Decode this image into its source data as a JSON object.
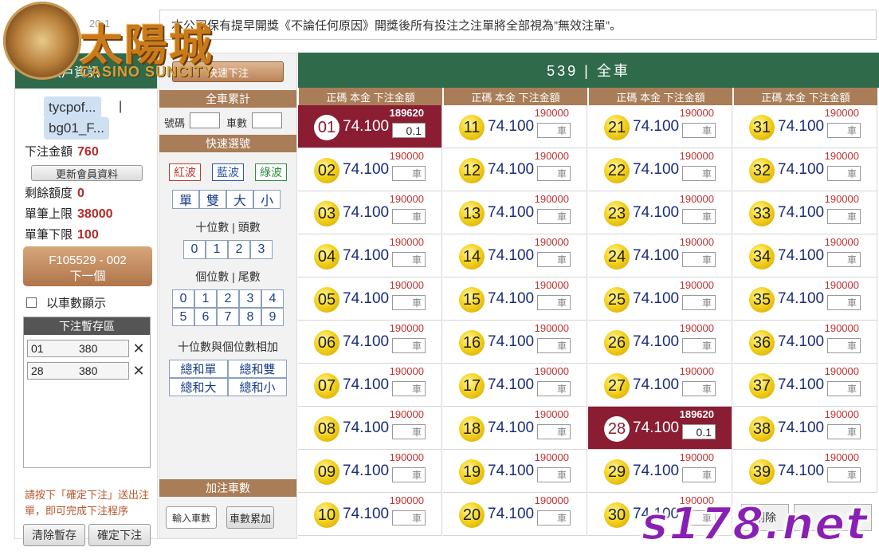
{
  "date_fragment": "20-1",
  "marquee": "本公司保有提早開獎《不論任何原因》開獎後所有投注之注單將全部視為”無效注單”。",
  "logo": {
    "title": "太陽城",
    "subtitle": "CASINO SUNCITY"
  },
  "member": {
    "header": "帳戶資訊",
    "user1": "tycpof...",
    "separator": "|",
    "user2": "bg01_F...",
    "bet_amount_label": "下注金額",
    "bet_amount": "760",
    "update_btn": "更新會員資料",
    "balance_label": "剩餘額度",
    "balance": "0",
    "max_label": "單筆上限",
    "max": "38000",
    "min_label": "單筆下限",
    "min": "100",
    "next_line1": "F105529 - 002",
    "next_line2": "下一個",
    "by_count_label": "以車數顯示",
    "stash_title": "下注暫存區",
    "stash": [
      {
        "num": "01",
        "amount": "380"
      },
      {
        "num": "28",
        "amount": "380"
      }
    ],
    "hint": "請按下「確定下注」送出注單，即可完成下注程序",
    "clear_btn": "清除暫存",
    "confirm_btn": "確定下注"
  },
  "quick": {
    "top_btn": "快速下注",
    "total_head": "全車累計",
    "num_label": "號碼",
    "count_label": "車數",
    "select_head": "快速選號",
    "waves": [
      "紅波",
      "藍波",
      "綠波"
    ],
    "wave_colors": [
      "#c0392b",
      "#2c5aa0",
      "#2e8b3e"
    ],
    "parity": [
      "單",
      "雙",
      "大",
      "小"
    ],
    "tens_label": "十位數 | 頭數",
    "tens": [
      "0",
      "1",
      "2",
      "3"
    ],
    "units_label": "個位數 | 尾數",
    "units_row1": [
      "0",
      "1",
      "2",
      "3",
      "4"
    ],
    "units_row2": [
      "5",
      "6",
      "7",
      "8",
      "9"
    ],
    "sum_label": "十位數與個位數相加",
    "sums": [
      "總和單",
      "總和雙",
      "總和大",
      "總和小"
    ],
    "add_head": "加注車數",
    "input_btn": "輸入車數",
    "accum_btn": "車數累加"
  },
  "main": {
    "title": "539 | 全車",
    "col_header": "正碼 本金 下注金額",
    "odds": "74.100",
    "limit_default": "190000",
    "limit_selected": "189620",
    "amt_placeholder": "車",
    "selected_amount": "0.1",
    "numbers": [
      "01",
      "02",
      "03",
      "04",
      "05",
      "06",
      "07",
      "08",
      "09",
      "10",
      "11",
      "12",
      "13",
      "14",
      "15",
      "16",
      "17",
      "18",
      "19",
      "20",
      "21",
      "22",
      "23",
      "24",
      "25",
      "26",
      "27",
      "28",
      "29",
      "30",
      "31",
      "32",
      "33",
      "34",
      "35",
      "36",
      "37",
      "38",
      "39"
    ],
    "selected": [
      "01",
      "28"
    ],
    "overlay_btn": "刪除"
  },
  "site_mark": "s178.net"
}
